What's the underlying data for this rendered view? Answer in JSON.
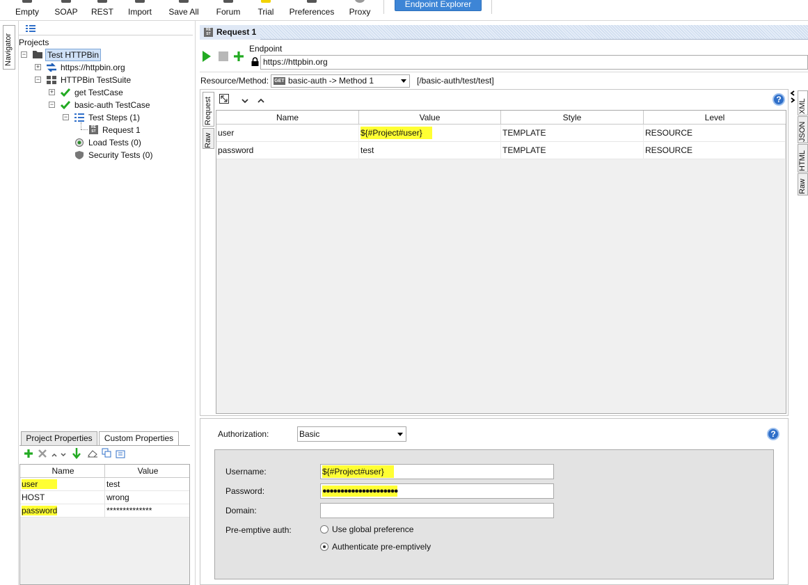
{
  "toolbar": {
    "buttons": [
      {
        "label": "Empty",
        "icon": "empty-icon"
      },
      {
        "label": "SOAP",
        "icon": "soap-icon"
      },
      {
        "label": "REST",
        "icon": "rest-icon"
      },
      {
        "label": "Import",
        "icon": "import-icon"
      },
      {
        "label": "Save All",
        "icon": "save-all-icon"
      },
      {
        "label": "Forum",
        "icon": "forum-icon"
      },
      {
        "label": "Trial",
        "icon": "trial-icon"
      },
      {
        "label": "Preferences",
        "icon": "preferences-icon"
      },
      {
        "label": "Proxy",
        "icon": "proxy-icon"
      }
    ],
    "endpoint_explorer": "Endpoint Explorer"
  },
  "navigator_tab": "Navigator",
  "tree": {
    "root_label": "Projects",
    "project": "Test HTTPBin",
    "interface": "https://httpbin.org",
    "suite": "HTTPBin TestSuite",
    "case1": "get TestCase",
    "case2": "basic-auth TestCase",
    "steps": "Test Steps (1)",
    "step1": "Request 1",
    "load": "Load Tests (0)",
    "security": "Security Tests (0)"
  },
  "properties": {
    "tab1": "Project Properties",
    "tab2": "Custom Properties",
    "col_name": "Name",
    "col_value": "Value",
    "rows": [
      {
        "name": "user",
        "value": "test",
        "highlight": true
      },
      {
        "name": "HOST",
        "value": "wrong",
        "highlight": false
      },
      {
        "name": "password",
        "value": "**************",
        "highlight": true
      }
    ]
  },
  "request": {
    "title": "Request 1",
    "endpoint_label": "Endpoint",
    "endpoint_value": "https://httpbin.org",
    "resource_label": "Resource/Method:",
    "resource_value": "basic-auth -> Method 1",
    "method_badge": "GET",
    "path": "[/basic-auth/test/test]",
    "tabs": {
      "request": "Request",
      "raw": "Raw"
    },
    "right_tabs": [
      "XML",
      "JSON",
      "HTML",
      "Raw"
    ],
    "columns": [
      "Name",
      "Value",
      "Style",
      "Level"
    ],
    "params": [
      {
        "name": "user",
        "value": "${#Project#user}",
        "style": "TEMPLATE",
        "level": "RESOURCE"
      },
      {
        "name": "password",
        "value": "test",
        "style": "TEMPLATE",
        "level": "RESOURCE"
      }
    ]
  },
  "auth": {
    "label": "Authorization:",
    "type": "Basic",
    "username_label": "Username:",
    "username_value": "${#Project#user}",
    "password_label": "Password:",
    "password_value": "●●●●●●●●●●●●●●●●●●●●●",
    "domain_label": "Domain:",
    "domain_value": "",
    "preemptive_label": "Pre-emptive auth:",
    "option1": "Use global preference",
    "option2": "Authenticate pre-emptively",
    "selected": "Authenticate pre-emptively"
  },
  "colors": {
    "highlight": "#ffff33",
    "accent": "#3d85d6",
    "play": "#22aa22"
  }
}
